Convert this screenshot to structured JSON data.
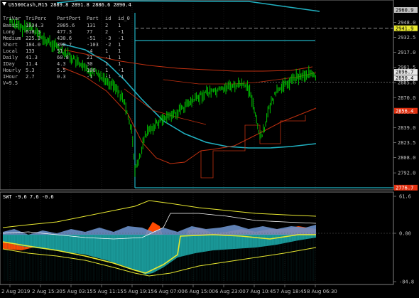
{
  "main": {
    "title": "US500Cash,M15  2889.8 2891.8 2886.6 2890.4",
    "ohlc_values": [
      2889.8,
      2891.8,
      2886.6,
      2890.4
    ],
    "table": {
      "headers": [
        "TriVar",
        "TriPerc",
        "PartPort",
        "Part",
        "id",
        "id_0"
      ],
      "rows": [
        {
          "label": "Basic",
          "c1": "1034.3",
          "c2": "2005.6",
          "c3": "131",
          "c4": "2",
          "c5": "1"
        },
        {
          "label": "Long",
          "c1": "618.3",
          "c2": "477.3",
          "c3": "77",
          "c4": "2",
          "c5": "-1"
        },
        {
          "label": "Medium",
          "c1": "225.3",
          "c2": "430.6",
          "c3": "-51",
          "c4": "-3",
          "c5": "-1"
        },
        {
          "label": "Short",
          "c1": "184.0",
          "c2": "390.7",
          "c3": "-103",
          "c4": "-2",
          "c5": "1"
        },
        {
          "label": "Local",
          "c1": "133",
          "c2": "51",
          "c3": "-4",
          "c4": "1",
          "c5": "1"
        },
        {
          "label": "Daily",
          "c1": "41.3",
          "c2": "60.8",
          "c3": "21",
          "c4": "-1",
          "c5": "1"
        },
        {
          "label": "IDay",
          "c1": "11.4",
          "c2": "4.3",
          "c3": "30",
          "c4": "1",
          "c5": "1"
        },
        {
          "label": "Hourly",
          "c1": "5.3",
          "c2": "5.5",
          "c3": "106",
          "c4": "1",
          "c5": "-1"
        },
        {
          "label": "IHour",
          "c1": "2.7",
          "c2": "0.3",
          "c3": "-1",
          "c4": "-1",
          "c5": "-1"
        }
      ],
      "footer": "V=9.5"
    },
    "price_axis": [
      "2948.0",
      "2932.5",
      "2917.0",
      "2901.5",
      "2885.6",
      "2870.0",
      "2855.2",
      "2839.0",
      "2823.5",
      "2808.0",
      "2792.0",
      "2776.6"
    ],
    "price_tags": [
      {
        "text": "2960.9",
        "color": "#c0c0c0",
        "text_color": "#000000"
      },
      {
        "text": "2941.9",
        "color": "#e8e830",
        "text_color": "#000000"
      },
      {
        "text": "2896.7",
        "color": "#e8e8e8",
        "text_color": "#000000"
      },
      {
        "text": "2890.4",
        "color": "#e8e8e8",
        "text_color": "#000000"
      },
      {
        "text": "2856.4",
        "color": "#e03010",
        "text_color": "#ffffff"
      },
      {
        "text": "2776.7",
        "color": "#e03010",
        "text_color": "#ffffff"
      }
    ]
  },
  "sub": {
    "title": "SWT -9.6 7.6 -0.6",
    "axis": [
      "61.6",
      "0.00",
      "-84.8"
    ]
  },
  "time_axis": [
    "2 Aug 2019",
    "2 Aug 15:30",
    "5 Aug 03:15",
    "5 Aug 11:15",
    "5 Aug 19:15",
    "6 Aug 07:00",
    "6 Aug 15:00",
    "6 Aug 23:00",
    "7 Aug 10:45",
    "7 Aug 18:45",
    "8 Aug 06:30"
  ],
  "colors": {
    "background": "#000000",
    "candles": "#00c000",
    "cyan_line": "#20b0c0",
    "red_line": "#c03010",
    "yellow_line": "#e8e830",
    "grid": "#303030",
    "orange_fill": "#ff4a00",
    "teal_fill": "#1a9a9a",
    "blue_fill": "#6a8fc8"
  }
}
